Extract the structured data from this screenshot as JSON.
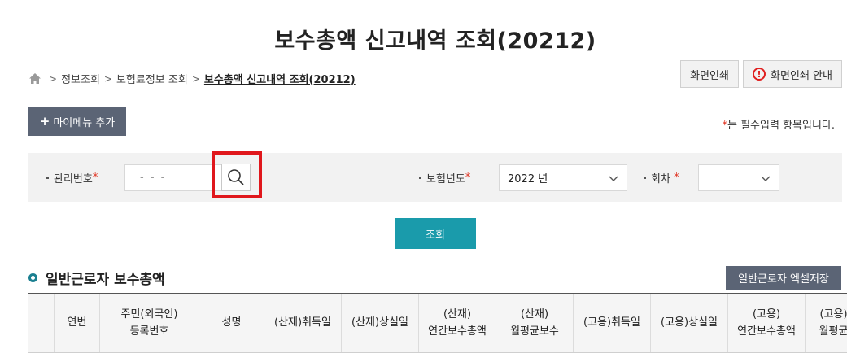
{
  "page": {
    "title": "보수총액 신고내역 조회(20212)"
  },
  "breadcrumb": {
    "items": [
      "정보조회",
      "보험료정보 조회"
    ],
    "current": "보수총액 신고내역 조회(20212)",
    "separator": ">"
  },
  "toolbar": {
    "print_label": "화면인쇄",
    "print_guide_label": "화면인쇄 안내",
    "print_guide_icon": "!",
    "mymenu_plus": "+",
    "mymenu_label": "마이메뉴 추가"
  },
  "required_note": {
    "mark": "*",
    "text": "는 필수입력 항목입니다."
  },
  "search": {
    "mgmt_label": "관리번호",
    "mgmt_placeholder": "- -   -",
    "year_label": "보험년도",
    "year_value": "2022 년",
    "round_label": "회차",
    "round_value": "",
    "required_mark": "*",
    "query_label": "조회"
  },
  "section": {
    "title": "일반근로자 보수총액",
    "excel_label": "일반근로자 엑셀저장"
  },
  "table": {
    "columns": [
      "",
      "연번",
      "주민(외국인)\n등록번호",
      "성명",
      "(산재)취득일",
      "(산재)상실일",
      "(산재)\n연간보수총액",
      "(산재)\n월평균보수",
      "(고용)취득일",
      "(고용)상실일",
      "(고용)\n연간보수총액",
      "(고용)\n월평균"
    ]
  },
  "colors": {
    "accent_teal": "#1a9bab",
    "button_slate": "#5b6475",
    "highlight_red": "#e0171c",
    "required_red": "#e0301e"
  }
}
